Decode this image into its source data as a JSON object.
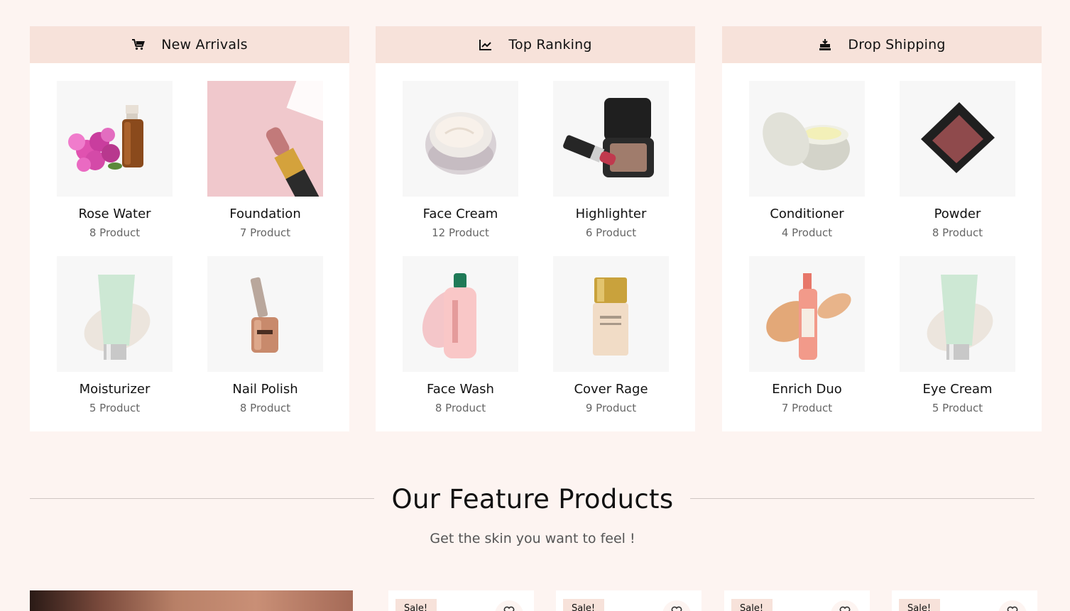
{
  "panels": [
    {
      "title": "New Arrivals",
      "icon": "cart-icon",
      "items": [
        {
          "name": "Rose Water",
          "count": "8 Product",
          "image": "rose-water-image"
        },
        {
          "name": "Foundation",
          "count": "7 Product",
          "image": "foundation-image"
        },
        {
          "name": "Moisturizer",
          "count": "5 Product",
          "image": "moisturizer-image"
        },
        {
          "name": "Nail Polish",
          "count": "8 Product",
          "image": "nail-polish-image"
        }
      ]
    },
    {
      "title": "Top Ranking",
      "icon": "chart-line-icon",
      "items": [
        {
          "name": "Face Cream",
          "count": "12 Product",
          "image": "face-cream-image"
        },
        {
          "name": "Highlighter",
          "count": "6 Product",
          "image": "highlighter-image"
        },
        {
          "name": "Face Wash",
          "count": "8 Product",
          "image": "face-wash-image"
        },
        {
          "name": "Cover Rage",
          "count": "9 Product",
          "image": "cover-rage-image"
        }
      ]
    },
    {
      "title": "Drop Shipping",
      "icon": "shipping-icon",
      "items": [
        {
          "name": "Conditioner",
          "count": "4 Product",
          "image": "conditioner-image"
        },
        {
          "name": "Powder",
          "count": "8 Product",
          "image": "powder-image"
        },
        {
          "name": "Enrich Duo",
          "count": "7 Product",
          "image": "enrich-duo-image"
        },
        {
          "name": "Eye Cream",
          "count": "5 Product",
          "image": "eye-cream-image"
        }
      ]
    }
  ],
  "feature": {
    "title": "Our Feature Products",
    "subtitle": "Get the skin you want to feel !"
  },
  "products": [
    {
      "badge": "Sale!"
    },
    {
      "badge": "Sale!"
    },
    {
      "badge": "Sale!"
    },
    {
      "badge": "Sale!"
    }
  ],
  "colors": {
    "page_bg": "#fdf4f1",
    "panel_header_bg": "#f7e2da",
    "thumb_bg": "#f7f7f7",
    "muted_text": "#666666"
  }
}
